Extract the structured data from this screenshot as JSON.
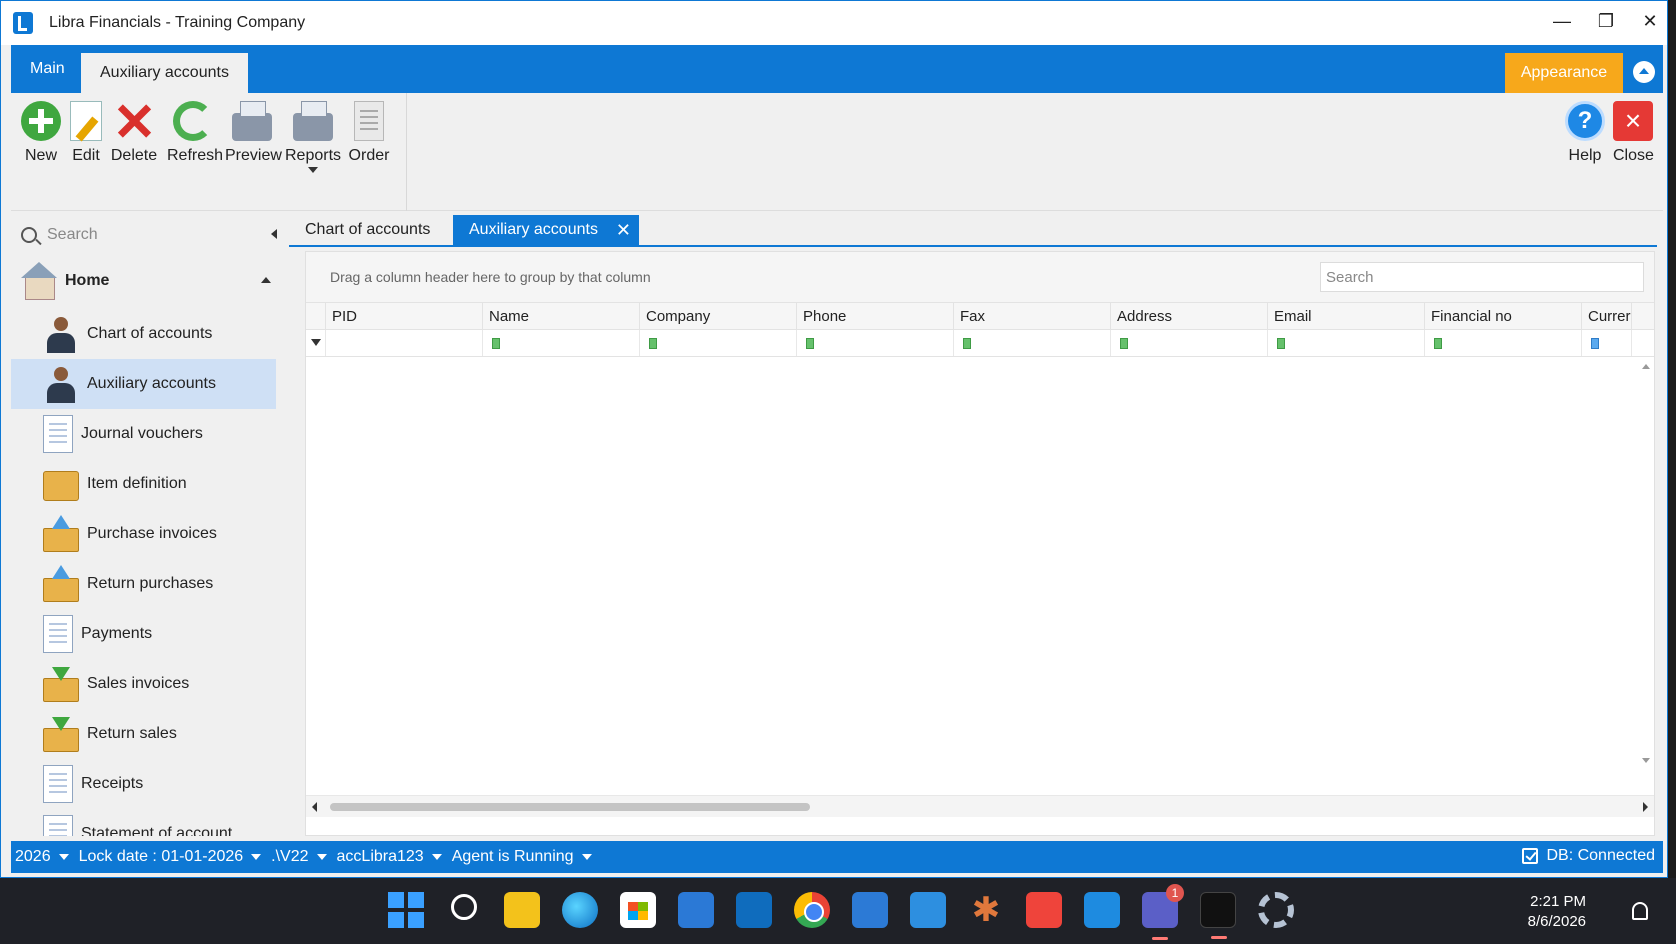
{
  "window": {
    "title": "Libra Financials - Training Company",
    "controls": [
      "minimize",
      "restore",
      "close"
    ]
  },
  "ribbon": {
    "tabs": [
      {
        "label": "Main"
      },
      {
        "label": "Auxiliary accounts"
      }
    ],
    "appearance_label": "Appearance",
    "buttons": [
      {
        "label": "New",
        "icon": "add-icon"
      },
      {
        "label": "Edit",
        "icon": "edit-icon"
      },
      {
        "label": "Delete",
        "icon": "delete-icon"
      },
      {
        "label": "Refresh",
        "icon": "refresh-icon"
      },
      {
        "label": "Preview",
        "icon": "printer-icon"
      },
      {
        "label": "Reports",
        "icon": "printer-icon"
      },
      {
        "label": "Order",
        "icon": "order-icon"
      }
    ],
    "help_label": "Help",
    "close_label": "Close"
  },
  "sidebar": {
    "search_placeholder": "Search",
    "home_label": "Home",
    "items": [
      {
        "label": "Chart of accounts",
        "icon": "person-icon"
      },
      {
        "label": "Auxiliary accounts",
        "icon": "person-icon",
        "selected": true
      },
      {
        "label": "Journal vouchers",
        "icon": "document-icon"
      },
      {
        "label": "Item definition",
        "icon": "box-icon"
      },
      {
        "label": "Purchase invoices",
        "icon": "tray-up-icon"
      },
      {
        "label": "Return purchases",
        "icon": "tray-up-icon"
      },
      {
        "label": "Payments",
        "icon": "document-icon"
      },
      {
        "label": "Sales invoices",
        "icon": "tray-down-icon"
      },
      {
        "label": "Return sales",
        "icon": "tray-down-icon"
      },
      {
        "label": "Receipts",
        "icon": "document-icon"
      },
      {
        "label": "Statement of account",
        "icon": "document-icon"
      }
    ]
  },
  "document_tabs": [
    {
      "label": "Chart of accounts"
    },
    {
      "label": "Auxiliary accounts",
      "active": true
    }
  ],
  "grid": {
    "group_hint": "Drag a column header here to group by that column",
    "search_placeholder": "Search",
    "columns": [
      "PID",
      "Name",
      "Company",
      "Phone",
      "Fax",
      "Address",
      "Email",
      "Financial no",
      "Currer"
    ],
    "rows": []
  },
  "statusbar": {
    "items": [
      "2026",
      "Lock date : 01-01-2026",
      ".\\V22",
      "accLibra123",
      "Agent is Running"
    ],
    "db_status": "DB: Connected"
  },
  "taskbar": {
    "time": "2:21 PM",
    "date": "8/6/2026",
    "teams_badge": "1"
  },
  "colors": {
    "accent": "#0e78d4",
    "appearance": "#f7a81b",
    "selected_row": "#cfe0f5"
  }
}
